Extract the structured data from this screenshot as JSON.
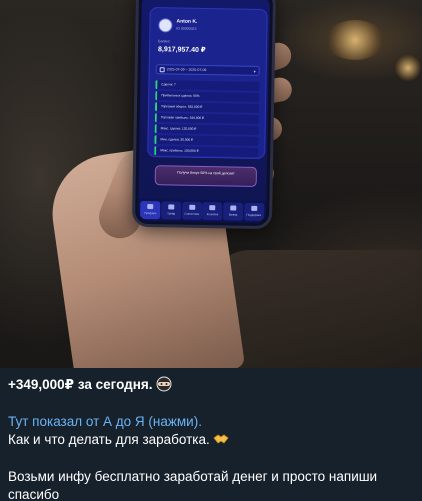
{
  "phone_screen": {
    "user_name": "Anton K.",
    "user_id": "ID 00000023",
    "balance_label": "Баланс",
    "balance": "8,917,957.40 ₽",
    "date_range": "2025-07-09 – 2025-07-09",
    "stats": [
      "Сделок: 7",
      "Прибыльных сделок: 60%",
      "Торговый оборот: 562,000 ₽",
      "Торговая прибыль: 349,000 ₽",
      "Макс. сделка: 120,000 ₽",
      "Мин. сделка: 30,000 ₽",
      "Макс. прибыль: 100,000 ₽"
    ],
    "bonus_button": "Получи бонус 50% на свой депозит",
    "nav": [
      "Профиль",
      "Трейд",
      "Статистика",
      "Кошелек",
      "Вывод",
      "Поддержка"
    ]
  },
  "message": {
    "line1": "+349,000₽ за сегодня.",
    "line1_emoji": "ninja-face-emoji",
    "link_text": "Тут показал от А до Я (нажми).",
    "line3": "Как и что делать для заработка.",
    "line3_emoji": "handshake-emoji",
    "line4": "Возьми инфу бесплатно заработай денег и просто напиши",
    "line5": "спасибо"
  },
  "colors": {
    "chat_background": "#17212b",
    "link": "#6ab3f3",
    "text": "#ffffff"
  }
}
